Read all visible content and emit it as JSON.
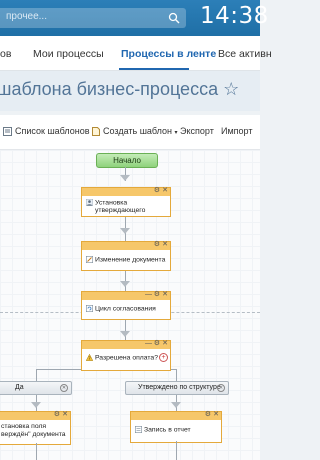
{
  "topbar": {
    "search_placeholder": "прочее...",
    "clock": "14:38"
  },
  "nav": {
    "items": [
      "ов",
      "Мои процессы",
      "Процессы в ленте",
      "Все активн"
    ]
  },
  "title": {
    "text": "шаблона бизнес-процесса ☆"
  },
  "toolbar": {
    "items": [
      "Список шаблонов",
      "Создать шаблон",
      "Экспорт",
      "Импорт"
    ],
    "dropdown_caret": "▾"
  },
  "canvas": {
    "start_label": "Начало",
    "blocks": [
      {
        "lines": [
          "Установка",
          "утверждающего"
        ],
        "icon": "user-icon"
      },
      {
        "lines": [
          "Изменение документа"
        ],
        "icon": "edit-document-icon"
      },
      {
        "lines": [
          "Цикл согласования"
        ],
        "icon": "cycle-icon"
      },
      {
        "lines": [
          "Разрешена оплата?"
        ],
        "icon": "question-icon"
      },
      {
        "lines": [
          "становка поля",
          "верждён\" документа"
        ],
        "icon": "field-icon"
      },
      {
        "lines": [
          "Запись в отчет"
        ],
        "icon": "report-icon"
      }
    ],
    "branches": [
      "Да",
      "Утверждено по структуре"
    ],
    "controls": {
      "settings": "⚙",
      "close": "✕",
      "minimize": "—",
      "add": "+"
    }
  },
  "colors": {
    "accent": "#2067b0",
    "topbar": "#1f6fa6",
    "block_header": "#f6c76a",
    "start": "#8fd27c"
  }
}
